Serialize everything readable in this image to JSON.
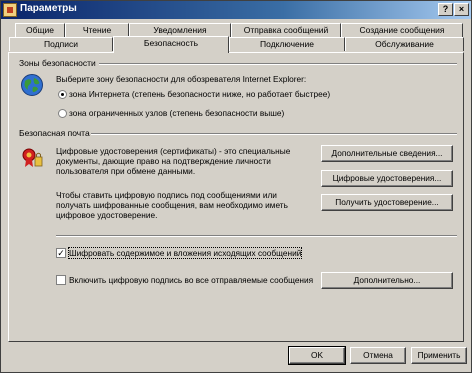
{
  "window": {
    "title": "Параметры",
    "help": "?",
    "close": "×"
  },
  "tabs_back": [
    "Общие",
    "Чтение",
    "Уведомления",
    "Отправка сообщений",
    "Создание сообщения"
  ],
  "tabs_front": [
    "Подписи",
    "Безопасность",
    "Подключение",
    "Обслуживание"
  ],
  "zones": {
    "title": "Зоны безопасности",
    "description": "Выберите зону безопасности для обозревателя Internet Explorer:",
    "options": [
      "зона Интернета (степень безопасности ниже, но работает быстрее)",
      "зона ограниченных узлов (степень безопасности выше)"
    ]
  },
  "secure_mail": {
    "title": "Безопасная почта",
    "info_lines": [
      "Цифровые удостоверения (сертификаты) - это специальные",
      "документы, дающие право на подтверждение личности",
      "пользователя при обмене данными."
    ],
    "sign_lines": [
      "Чтобы ставить цифровую подпись под сообщениями или",
      "получать шифрованные сообщения, вам необходимо иметь",
      "цифровое удостоверение."
    ],
    "more_info_button": "Дополнительные сведения...",
    "ids_button": "Цифровые удостоверения...",
    "get_id_button": "Получить удостоверение...",
    "encrypt_label": "Шифровать содержимое и вложения исходящих сообщений",
    "sign_label": "Включить цифровую подпись во все отправляемые сообщения",
    "advanced_button": "Дополнительно..."
  },
  "footer": {
    "ok": "OK",
    "cancel": "Отмена",
    "apply": "Применить"
  }
}
